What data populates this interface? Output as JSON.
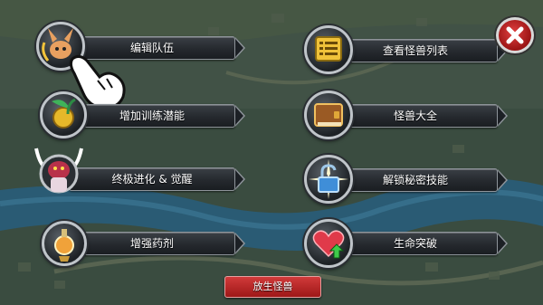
{
  "menu_left": [
    {
      "label": "编辑队伍",
      "icon": "rabbit-monster-icon"
    },
    {
      "label": "增加训练潜能",
      "icon": "leaf-medal-icon"
    },
    {
      "label": "终极进化 & 觉醒",
      "icon": "evolved-monster-icon"
    },
    {
      "label": "增强药剂",
      "icon": "potion-flask-icon"
    }
  ],
  "menu_right": [
    {
      "label": "查看怪兽列表",
      "icon": "list-scroll-icon"
    },
    {
      "label": "怪兽大全",
      "icon": "book-icon"
    },
    {
      "label": "解锁秘密技能",
      "icon": "unlock-padlock-icon"
    },
    {
      "label": "生命突破",
      "icon": "heart-up-icon"
    }
  ],
  "release_button": {
    "label": "放生怪兽"
  },
  "close_button": {
    "icon": "close-icon"
  },
  "colors": {
    "close_red": "#c42020",
    "release_red": "#b82626",
    "plate_dark": "#25292e"
  }
}
